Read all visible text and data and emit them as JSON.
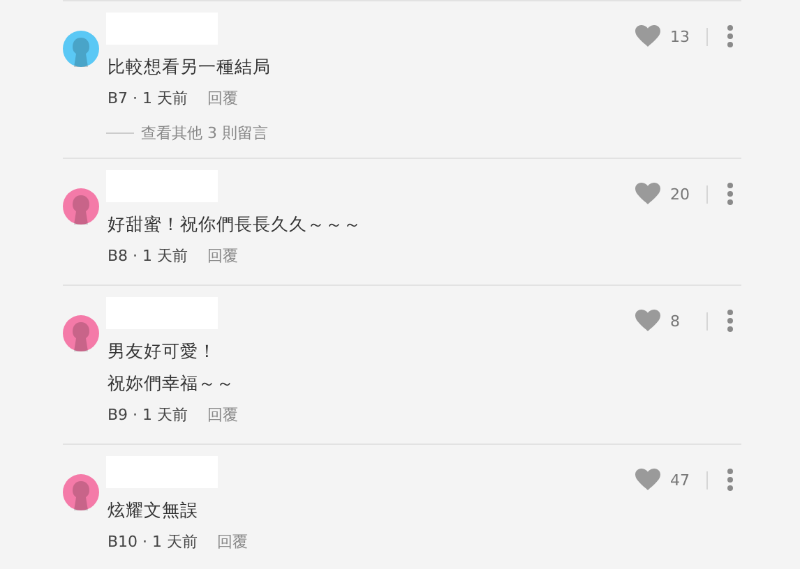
{
  "comments": [
    {
      "color": "#5ac8f5",
      "lines": [
        "比較想看另一種結局"
      ],
      "floor": "B7",
      "dot": "·",
      "time": "1 天前",
      "reply": "回覆",
      "likes": "13",
      "more_replies": "查看其他 3 則留言"
    },
    {
      "color": "#f47aa8",
      "lines": [
        "好甜蜜！祝你們長長久久～～～"
      ],
      "floor": "B8",
      "dot": "·",
      "time": "1 天前",
      "reply": "回覆",
      "likes": "20"
    },
    {
      "color": "#f47aa8",
      "lines": [
        "男友好可愛！",
        "祝妳們幸福～～"
      ],
      "floor": "B9",
      "dot": "·",
      "time": "1 天前",
      "reply": "回覆",
      "likes": "8"
    },
    {
      "color": "#f47aa8",
      "lines": [
        "炫耀文無誤"
      ],
      "floor": "B10",
      "dot": "·",
      "time": "1 天前",
      "reply": "回覆",
      "likes": "47"
    }
  ]
}
